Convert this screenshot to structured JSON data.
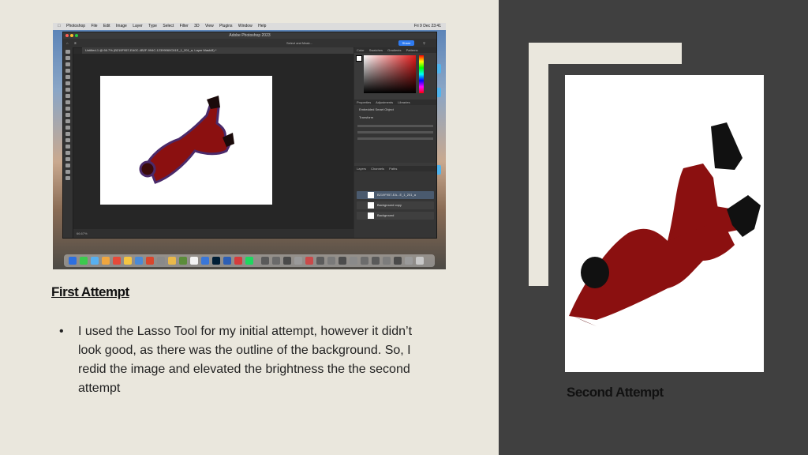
{
  "slide": {
    "first_caption": "First Attempt",
    "bullet_text": "I used the Lasso Tool for my initial attempt, however it didn’t look good, as there was the outline of the background. So, I redid the image and elevated the brightness the the second attempt",
    "second_caption": "Second Attempt"
  },
  "screenshot": {
    "menubar_items": [
      "Photoshop",
      "File",
      "Edit",
      "Image",
      "Layer",
      "Type",
      "Select",
      "Filter",
      "3D",
      "View",
      "Plugins",
      "Window",
      "Help"
    ],
    "clock": "Fri 9 Dec 23:41",
    "window_title": "Adobe Photoshop 2023",
    "share_label": "Share",
    "select_mask_label": "Select and Mask...",
    "doc_tab": "Untitled-1 @ 66.7% (B219F957-EA0C-4B2F-994C-12399060C61E_1_201_a, Layer Mask/8) *",
    "zoom_status": "66.67%",
    "panel_tabs_top": [
      "Color",
      "Swatches",
      "Gradients",
      "Patterns"
    ],
    "panel_tabs_props": [
      "Properties",
      "Adjustments",
      "Libraries"
    ],
    "props_title": "Embedded Smart Object",
    "transform_label": "Transform",
    "panel_tabs_layers": [
      "Layers",
      "Channels",
      "Paths"
    ],
    "layers": [
      "B219F957-EA...E_1_201_a",
      "Background copy",
      "Background"
    ],
    "colors": {
      "accent": "#2f7bf0",
      "swatch_red": "#e11a1a"
    }
  },
  "colors": {
    "left_bg": "#eae7dd",
    "right_bg": "#404040",
    "figure_red": "#8b1010"
  }
}
